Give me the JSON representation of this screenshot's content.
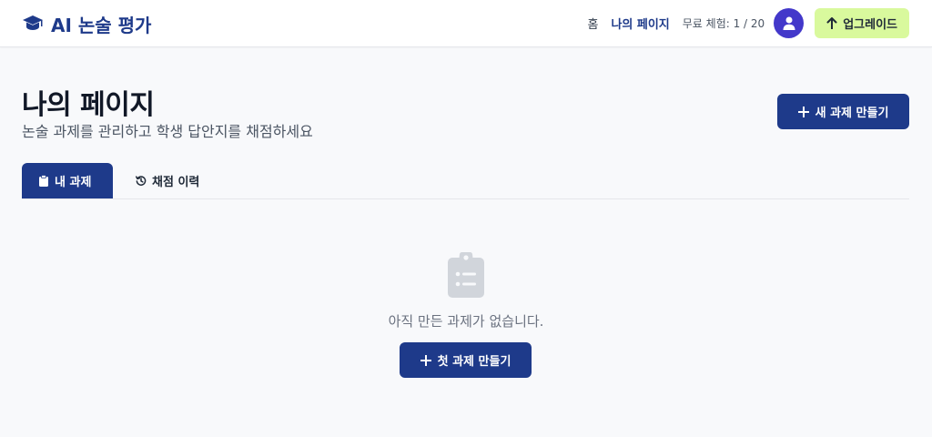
{
  "header": {
    "brand": "AI 논술 평가",
    "nav_home": "홈",
    "nav_mypage": "나의 페이지",
    "trial_text": "무료 체험: 1 / 20",
    "upgrade_label": "업그레이드"
  },
  "page": {
    "title": "나의 페이지",
    "subtitle": "논술 과제를 관리하고 학생 답안지를 채점하세요",
    "new_task_label": "새 과제 만들기"
  },
  "tabs": [
    {
      "label": "내 과제",
      "active": true
    },
    {
      "label": "채점 이력",
      "active": false
    }
  ],
  "empty_state": {
    "message": "아직 만든 과제가 없습니다.",
    "button_label": "첫 과제 만들기"
  },
  "colors": {
    "primary": "#1e3a8a",
    "avatar": "#4338ca",
    "upgrade_bg": "#d9f99d",
    "page_bg": "#f8f9fb"
  },
  "icons": {
    "brand": "graduation-cap-icon",
    "avatar": "user-icon",
    "upgrade": "arrow-up-icon",
    "new_task": "plus-icon",
    "tab_tasks": "clipboard-icon",
    "tab_history": "history-icon",
    "empty": "clipboard-list-icon"
  }
}
